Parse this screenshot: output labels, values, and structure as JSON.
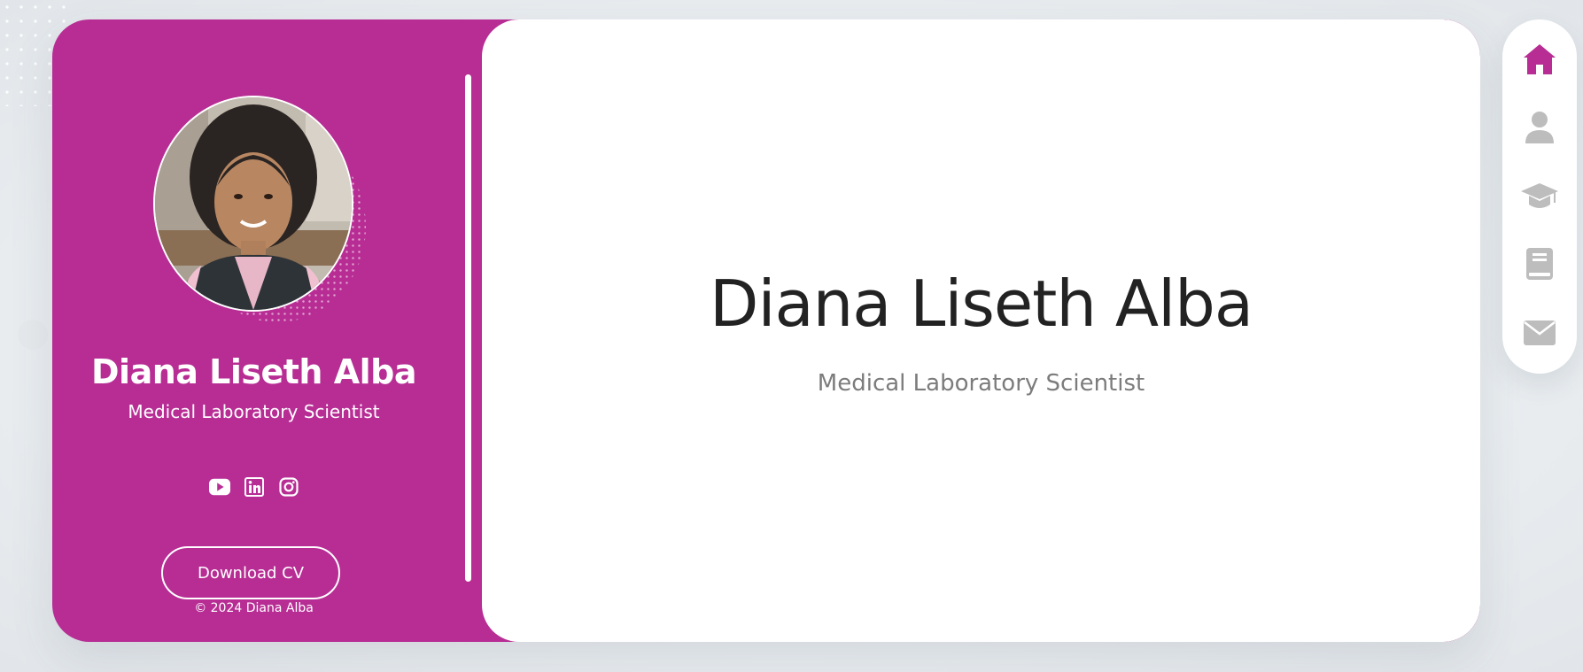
{
  "colors": {
    "accent": "#b72d94",
    "nav_active": "#b72d94",
    "nav_inactive": "#bdbdbd",
    "heading": "#222222",
    "subheading": "#7c7c7c"
  },
  "sidebar": {
    "avatar": "profile-photo",
    "name": "Diana Liseth Alba",
    "role": "Medical Laboratory Scientist",
    "socials": [
      {
        "icon": "youtube-icon"
      },
      {
        "icon": "linkedin-icon"
      },
      {
        "icon": "instagram-icon"
      }
    ],
    "download_label": "Download CV",
    "copyright": "© 2024 Diana Alba"
  },
  "main": {
    "name": "Diana Liseth Alba",
    "role": "Medical Laboratory Scientist"
  },
  "nav": {
    "items": [
      {
        "icon": "home-icon",
        "active": true
      },
      {
        "icon": "user-icon",
        "active": false
      },
      {
        "icon": "graduation-cap-icon",
        "active": false
      },
      {
        "icon": "book-icon",
        "active": false
      },
      {
        "icon": "envelope-icon",
        "active": false
      }
    ]
  }
}
